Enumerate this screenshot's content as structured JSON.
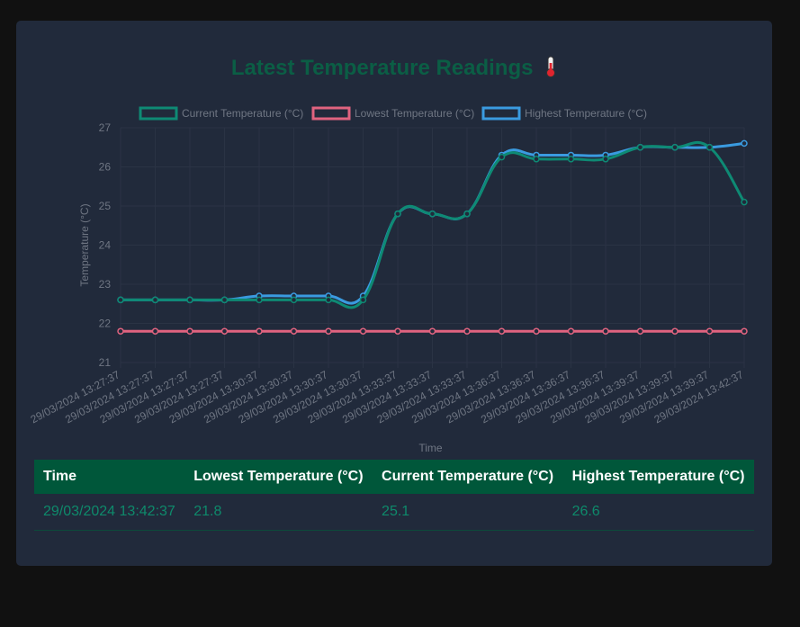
{
  "page": {
    "title": "Latest Temperature Readings"
  },
  "colors": {
    "current": "#0e8a74",
    "lowest": "#e0637f",
    "highest": "#3a9be0",
    "title": "#0b5e45",
    "grid": "#2a3344",
    "tick": "#6f7683"
  },
  "chart_data": {
    "type": "line",
    "xlabel": "Time",
    "ylabel": "Temperature (°C)",
    "ylim": [
      21,
      27
    ],
    "yticks": [
      21,
      22,
      23,
      24,
      25,
      26,
      27
    ],
    "grid": true,
    "legend_position": "top",
    "x": [
      "29/03/2024 13:27:37",
      "29/03/2024 13:27:37",
      "29/03/2024 13:27:37",
      "29/03/2024 13:27:37",
      "29/03/2024 13:30:37",
      "29/03/2024 13:30:37",
      "29/03/2024 13:30:37",
      "29/03/2024 13:30:37",
      "29/03/2024 13:33:37",
      "29/03/2024 13:33:37",
      "29/03/2024 13:33:37",
      "29/03/2024 13:36:37",
      "29/03/2024 13:36:37",
      "29/03/2024 13:36:37",
      "29/03/2024 13:36:37",
      "29/03/2024 13:39:37",
      "29/03/2024 13:39:37",
      "29/03/2024 13:39:37",
      "29/03/2024 13:42:37"
    ],
    "series": [
      {
        "name": "Current Temperature (°C)",
        "color": "#0e8a74",
        "values": [
          22.6,
          22.6,
          22.6,
          22.6,
          22.6,
          22.6,
          22.6,
          22.6,
          24.8,
          24.8,
          24.8,
          26.25,
          26.2,
          26.2,
          26.2,
          26.5,
          26.5,
          26.5,
          25.1
        ]
      },
      {
        "name": "Lowest Temperature (°C)",
        "color": "#e0637f",
        "values": [
          21.8,
          21.8,
          21.8,
          21.8,
          21.8,
          21.8,
          21.8,
          21.8,
          21.8,
          21.8,
          21.8,
          21.8,
          21.8,
          21.8,
          21.8,
          21.8,
          21.8,
          21.8,
          21.8
        ]
      },
      {
        "name": "Highest Temperature (°C)",
        "color": "#3a9be0",
        "values": [
          22.6,
          22.6,
          22.6,
          22.6,
          22.7,
          22.7,
          22.7,
          22.7,
          24.8,
          24.8,
          24.8,
          26.3,
          26.3,
          26.3,
          26.3,
          26.5,
          26.5,
          26.5,
          26.6
        ]
      }
    ]
  },
  "table": {
    "headers": [
      "Time",
      "Lowest Temperature (°C)",
      "Current Temperature (°C)",
      "Highest Temperature (°C)"
    ],
    "rows": [
      [
        "29/03/2024 13:42:37",
        "21.8",
        "25.1",
        "26.6"
      ]
    ]
  }
}
